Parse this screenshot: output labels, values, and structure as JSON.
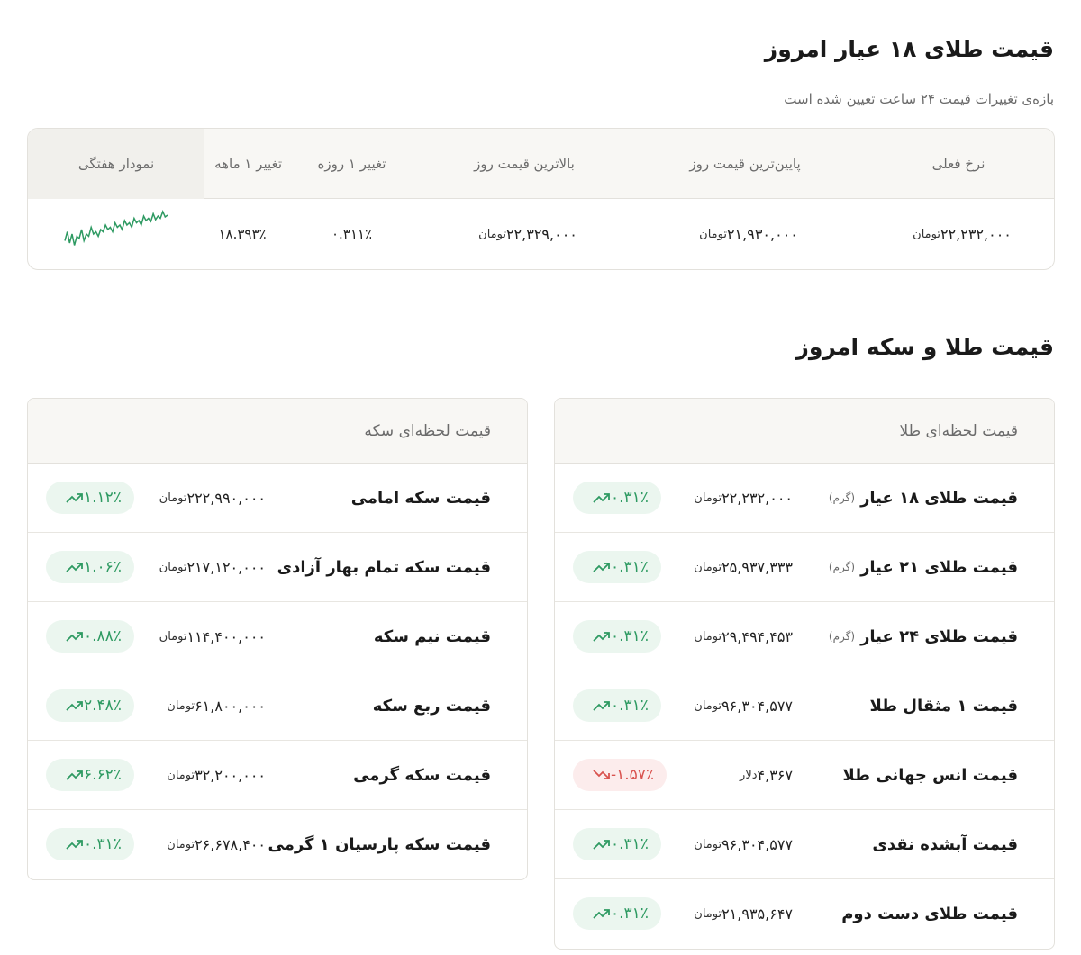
{
  "section1": {
    "title": "قیمت طلای ۱۸ عیار امروز",
    "subtitle": "بازه‌ی تغییرات قیمت ۲۴ ساعت تعیین شده است",
    "headers": [
      "نرخ فعلی",
      "پایین‌ترین قیمت روز",
      "بالاترین قیمت روز",
      "تغییر ۱ روزه",
      "تغییر ۱ ماهه",
      "نمودار هفتگی"
    ],
    "current": "۲۲,۲۳۲,۰۰۰",
    "low": "۲۱,۹۳۰,۰۰۰",
    "high": "۲۲,۳۲۹,۰۰۰",
    "unit": "تومان",
    "change_day": "۰.۳۱۱٪",
    "change_month": "۱۸.۳۹۳٪",
    "sparkline": [
      0.35,
      0.55,
      0.3,
      0.5,
      0.25,
      0.45,
      0.4,
      0.6,
      0.35,
      0.5,
      0.45,
      0.65,
      0.5,
      0.55,
      0.45,
      0.6,
      0.55,
      0.7,
      0.6,
      0.65,
      0.55,
      0.75,
      0.65,
      0.7,
      0.6,
      0.8,
      0.7,
      0.75,
      0.65,
      0.85,
      0.75,
      0.8,
      0.7,
      0.9,
      0.8,
      0.85,
      0.78,
      0.95,
      0.82,
      0.9,
      0.85,
      1.0,
      0.88,
      0.92
    ]
  },
  "section2": {
    "title": "قیمت طلا و سکه امروز"
  },
  "gold_panel": {
    "header": "قیمت لحظه‌ای طلا",
    "rows": [
      {
        "name": "قیمت طلای ۱۸ عیار",
        "gram": "(گرم)",
        "price": "۲۲,۲۳۲,۰۰۰",
        "unit": "تومان",
        "change": "۰.۳۱٪",
        "dir": "up"
      },
      {
        "name": "قیمت طلای ۲۱ عیار",
        "gram": "(گرم)",
        "price": "۲۵,۹۳۷,۳۳۳",
        "unit": "تومان",
        "change": "۰.۳۱٪",
        "dir": "up"
      },
      {
        "name": "قیمت طلای ۲۴ عیار",
        "gram": "(گرم)",
        "price": "۲۹,۴۹۴,۴۵۳",
        "unit": "تومان",
        "change": "۰.۳۱٪",
        "dir": "up"
      },
      {
        "name": "قیمت ۱ مثقال طلا",
        "gram": "",
        "price": "۹۶,۳۰۴,۵۷۷",
        "unit": "تومان",
        "change": "۰.۳۱٪",
        "dir": "up"
      },
      {
        "name": "قیمت انس جهانی طلا",
        "gram": "",
        "price": "۴,۳۶۷",
        "unit": "دلار",
        "change": "-۱.۵۷٪",
        "dir": "down"
      },
      {
        "name": "قیمت آبشده نقدی",
        "gram": "",
        "price": "۹۶,۳۰۴,۵۷۷",
        "unit": "تومان",
        "change": "۰.۳۱٪",
        "dir": "up"
      },
      {
        "name": "قیمت طلای دست دوم",
        "gram": "",
        "price": "۲۱,۹۳۵,۶۴۷",
        "unit": "تومان",
        "change": "۰.۳۱٪",
        "dir": "up"
      }
    ]
  },
  "coin_panel": {
    "header": "قیمت لحظه‌ای سکه",
    "rows": [
      {
        "name": "قیمت سکه امامی",
        "price": "۲۲۲,۹۹۰,۰۰۰",
        "unit": "تومان",
        "change": "۱.۱۲٪",
        "dir": "up"
      },
      {
        "name": "قیمت سکه تمام بهار آزادی",
        "price": "۲۱۷,۱۲۰,۰۰۰",
        "unit": "تومان",
        "change": "۱.۰۶٪",
        "dir": "up"
      },
      {
        "name": "قیمت نیم سکه",
        "price": "۱۱۴,۴۰۰,۰۰۰",
        "unit": "تومان",
        "change": "۰.۸۸٪",
        "dir": "up"
      },
      {
        "name": "قیمت ربع سکه",
        "price": "۶۱,۸۰۰,۰۰۰",
        "unit": "تومان",
        "change": "۲.۴۸٪",
        "dir": "up"
      },
      {
        "name": "قیمت سکه گرمی",
        "price": "۳۲,۲۰۰,۰۰۰",
        "unit": "تومان",
        "change": "۶.۶۲٪",
        "dir": "up"
      },
      {
        "name": "قیمت سکه پارسیان ۱ گرمی",
        "price": "۲۶,۶۷۸,۴۰۰",
        "unit": "تومان",
        "change": "۰.۳۱٪",
        "dir": "up"
      }
    ]
  },
  "colors": {
    "up": "#2e9a62",
    "down": "#d9534f"
  }
}
